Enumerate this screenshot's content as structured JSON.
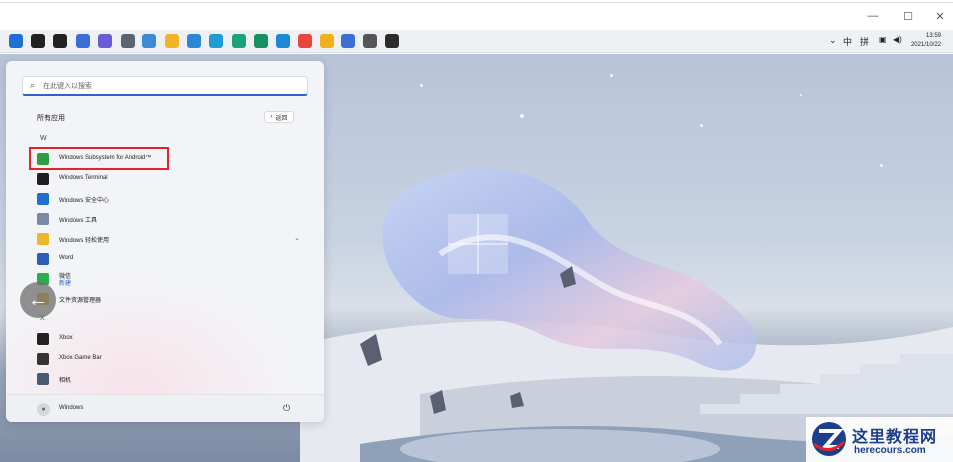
{
  "window_controls": {
    "minimize": "—",
    "maximize": "☐",
    "close": "✕"
  },
  "taskbar": {
    "icons": [
      {
        "name": "start-icon",
        "color": "#1e6fd6"
      },
      {
        "name": "search-icon",
        "color": "#222222"
      },
      {
        "name": "task-view-icon",
        "color": "#222222"
      },
      {
        "name": "widgets-icon",
        "color": "#3b6fd8"
      },
      {
        "name": "chat-icon",
        "color": "#6b5bd6"
      },
      {
        "name": "settings-icon",
        "color": "#5b6473"
      },
      {
        "name": "control-panel-icon",
        "color": "#3d8bd6"
      },
      {
        "name": "file-explorer-icon",
        "color": "#f0b429"
      },
      {
        "name": "store-icon",
        "color": "#2b88d8"
      },
      {
        "name": "edge-icon",
        "color": "#1f9bd6"
      },
      {
        "name": "edge-beta-icon",
        "color": "#1aa37a"
      },
      {
        "name": "edge-dev-icon",
        "color": "#15925f"
      },
      {
        "name": "edge-canary-icon",
        "color": "#1a8ad6"
      },
      {
        "name": "chrome-icon",
        "color": "#e8453c"
      },
      {
        "name": "chrome-canary-icon",
        "color": "#f2b01e"
      },
      {
        "name": "chrome-beta-icon",
        "color": "#3c6fd6"
      },
      {
        "name": "chrome-dev-icon",
        "color": "#555555"
      },
      {
        "name": "terminal-icon",
        "color": "#2b2b2b"
      }
    ],
    "tray": {
      "chevron": "⌄",
      "ime_mode": "中",
      "ime_layout": "拼",
      "time": "13:59",
      "date": "2021/10/22"
    }
  },
  "start_menu": {
    "search_placeholder": "在此键入以搜索",
    "all_apps_title": "所有应用",
    "back_label": "返回",
    "group_w": "W",
    "group_x": "X",
    "apps": [
      {
        "label": "Windows Subsystem for Android™",
        "icon": "android-subsystem-icon",
        "color": "#2e9e44"
      },
      {
        "label": "Windows Terminal",
        "icon": "terminal-icon",
        "color": "#1f1f1f"
      },
      {
        "label": "Windows 安全中心",
        "icon": "shield-icon",
        "color": "#1f6fd0"
      },
      {
        "label": "Windows 工具",
        "icon": "tools-icon",
        "color": "#7b8aa0"
      },
      {
        "label": "Windows 轻松使用",
        "icon": "folder-icon",
        "color": "#f1b52b"
      },
      {
        "label": "Word",
        "icon": "word-icon",
        "color": "#2b5fb8"
      },
      {
        "label": "微信",
        "sub": "新建",
        "icon": "wechat-icon",
        "color": "#2aae4a"
      },
      {
        "label": "文件资源管理器",
        "icon": "file-explorer-icon",
        "color": "#f1b52b"
      },
      {
        "label": "Xbox",
        "icon": "xbox-icon",
        "color": "#222222"
      },
      {
        "label": "Xbox Game Bar",
        "icon": "xbox-game-bar-icon",
        "color": "#333333"
      },
      {
        "label": "相机",
        "icon": "camera-icon",
        "color": "#4a5a72"
      }
    ],
    "user_name": "Windows"
  },
  "watermark": {
    "title": "这里教程网",
    "domain": "herecours.com"
  }
}
